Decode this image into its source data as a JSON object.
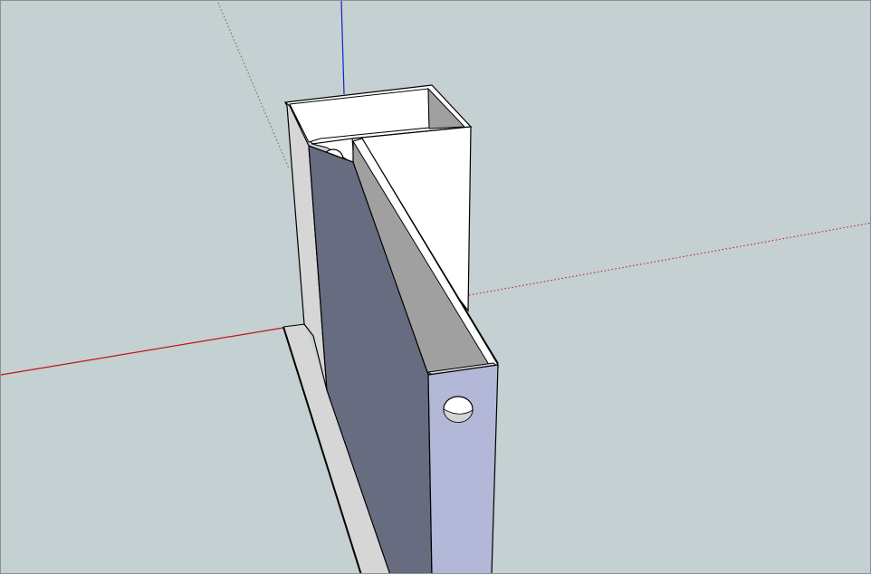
{
  "viewport": {
    "background_color": "#c4d0d1",
    "border_color": "#8a8f92"
  },
  "axes": {
    "red_axis_color": "#c0131b",
    "green_axis_color": "#2f8a3a",
    "blue_axis_color": "#1020d0"
  },
  "model": {
    "edge_color": "#000000",
    "white_face_color": "#ffffff",
    "light_gray_face_color": "#d6d6d6",
    "mid_gray_face_color": "#a0a0a0",
    "dark_slate_face_color": "#686c80",
    "lavender_face_color": "#b3b8d8",
    "hole_shade_color": "#d4d4d4"
  }
}
